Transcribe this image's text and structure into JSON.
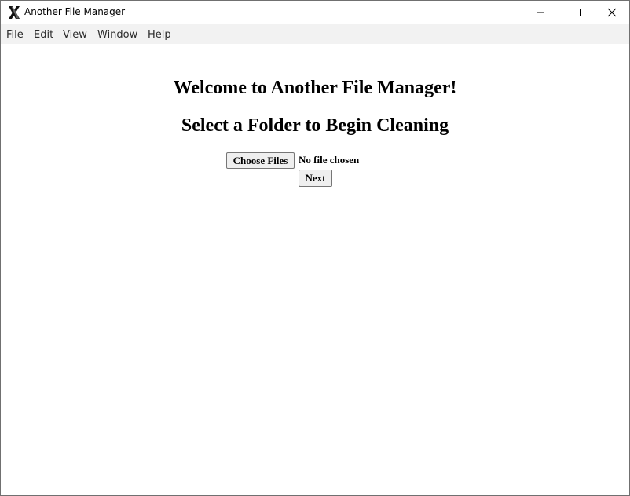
{
  "window": {
    "title": "Another File Manager",
    "app_icon": "x-logo-icon",
    "controls": [
      "minimize-icon",
      "maximize-icon",
      "close-icon"
    ]
  },
  "menubar": {
    "items": [
      {
        "label": "File"
      },
      {
        "label": "Edit"
      },
      {
        "label": "View"
      },
      {
        "label": "Window"
      },
      {
        "label": "Help"
      }
    ]
  },
  "main": {
    "welcome_heading": "Welcome to Another File Manager!",
    "select_heading": "Select a Folder to Begin Cleaning",
    "file_input": {
      "button_label": "Choose Files",
      "status_text": "No file chosen"
    },
    "next_label": "Next"
  }
}
